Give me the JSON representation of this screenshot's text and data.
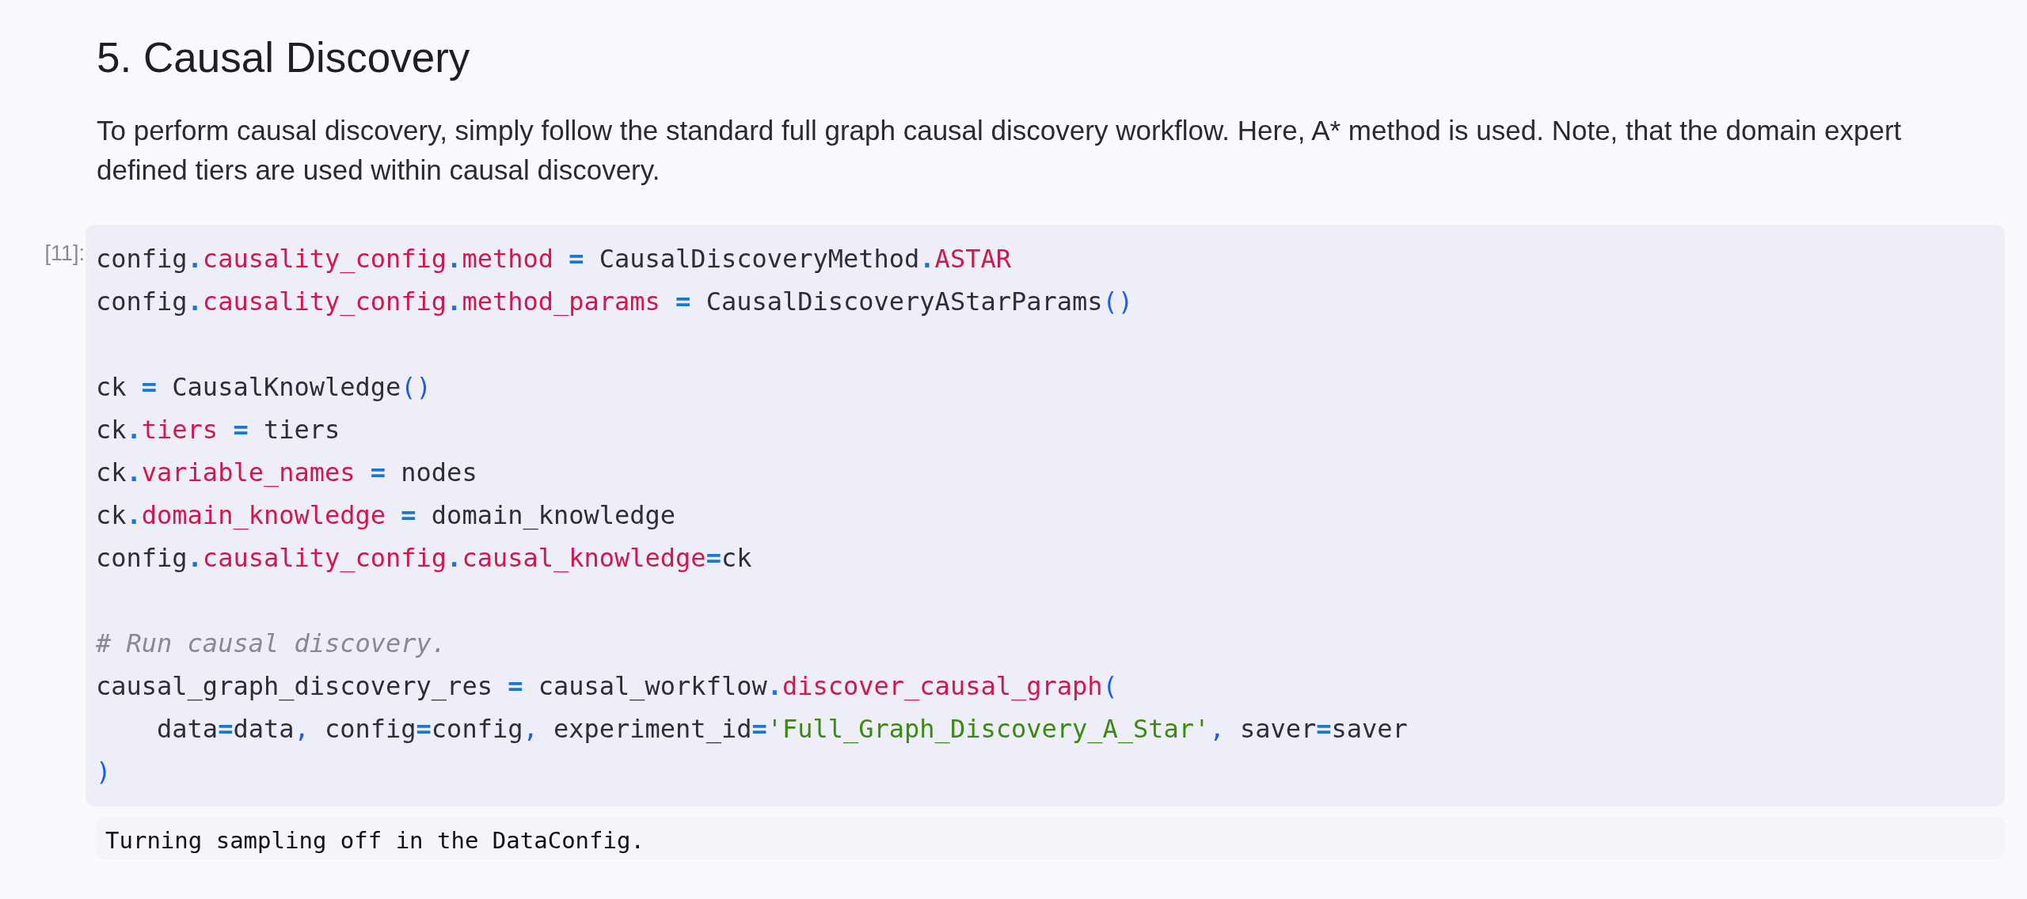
{
  "markdown": {
    "heading": "5. Causal Discovery",
    "paragraph": "To perform causal discovery, simply follow the standard full graph causal discovery workflow. Here, A* method is used. Note, that the domain expert defined tiers are used within causal discovery."
  },
  "code_cell": {
    "prompt": "[11]:",
    "blocks": [
      {
        "lines": [
          [
            {
              "kind": "name",
              "text": "config"
            },
            {
              "kind": "op",
              "text": "."
            },
            {
              "kind": "attr",
              "text": "causality_config"
            },
            {
              "kind": "op",
              "text": "."
            },
            {
              "kind": "attr",
              "text": "method"
            },
            {
              "kind": "op",
              "text": " = "
            },
            {
              "kind": "name",
              "text": "CausalDiscoveryMethod"
            },
            {
              "kind": "op",
              "text": "."
            },
            {
              "kind": "attr",
              "text": "ASTAR"
            }
          ],
          [
            {
              "kind": "name",
              "text": "config"
            },
            {
              "kind": "op",
              "text": "."
            },
            {
              "kind": "attr",
              "text": "causality_config"
            },
            {
              "kind": "op",
              "text": "."
            },
            {
              "kind": "attr",
              "text": "method_params"
            },
            {
              "kind": "op",
              "text": " = "
            },
            {
              "kind": "name",
              "text": "CausalDiscoveryAStarParams"
            },
            {
              "kind": "punct",
              "text": "()"
            }
          ]
        ]
      },
      {
        "lines": [
          [
            {
              "kind": "name",
              "text": "ck"
            },
            {
              "kind": "op",
              "text": " = "
            },
            {
              "kind": "name",
              "text": "CausalKnowledge"
            },
            {
              "kind": "punct",
              "text": "()"
            }
          ],
          [
            {
              "kind": "name",
              "text": "ck"
            },
            {
              "kind": "op",
              "text": "."
            },
            {
              "kind": "attr",
              "text": "tiers"
            },
            {
              "kind": "op",
              "text": " = "
            },
            {
              "kind": "name",
              "text": "tiers"
            }
          ],
          [
            {
              "kind": "name",
              "text": "ck"
            },
            {
              "kind": "op",
              "text": "."
            },
            {
              "kind": "attr",
              "text": "variable_names"
            },
            {
              "kind": "op",
              "text": " = "
            },
            {
              "kind": "name",
              "text": "nodes"
            }
          ],
          [
            {
              "kind": "name",
              "text": "ck"
            },
            {
              "kind": "op",
              "text": "."
            },
            {
              "kind": "attr",
              "text": "domain_knowledge"
            },
            {
              "kind": "op",
              "text": " = "
            },
            {
              "kind": "name",
              "text": "domain_knowledge"
            }
          ],
          [
            {
              "kind": "name",
              "text": "config"
            },
            {
              "kind": "op",
              "text": "."
            },
            {
              "kind": "attr",
              "text": "causality_config"
            },
            {
              "kind": "op",
              "text": "."
            },
            {
              "kind": "attr",
              "text": "causal_knowledge"
            },
            {
              "kind": "op",
              "text": "="
            },
            {
              "kind": "name",
              "text": "ck"
            }
          ]
        ]
      },
      {
        "lines": [
          [
            {
              "kind": "comment",
              "text": "# Run causal discovery."
            }
          ],
          [
            {
              "kind": "name",
              "text": "causal_graph_discovery_res"
            },
            {
              "kind": "op",
              "text": " = "
            },
            {
              "kind": "name",
              "text": "causal_workflow"
            },
            {
              "kind": "op",
              "text": "."
            },
            {
              "kind": "attr",
              "text": "discover_causal_graph"
            },
            {
              "kind": "punct",
              "text": "("
            }
          ],
          [
            {
              "kind": "name",
              "text": "    data"
            },
            {
              "kind": "op",
              "text": "="
            },
            {
              "kind": "name",
              "text": "data"
            },
            {
              "kind": "punct",
              "text": ","
            },
            {
              "kind": "name",
              "text": " config"
            },
            {
              "kind": "op",
              "text": "="
            },
            {
              "kind": "name",
              "text": "config"
            },
            {
              "kind": "punct",
              "text": ","
            },
            {
              "kind": "name",
              "text": " experiment_id"
            },
            {
              "kind": "op",
              "text": "="
            },
            {
              "kind": "string",
              "text": "'Full_Graph_Discovery_A_Star'"
            },
            {
              "kind": "punct",
              "text": ","
            },
            {
              "kind": "name",
              "text": " saver"
            },
            {
              "kind": "op",
              "text": "="
            },
            {
              "kind": "name",
              "text": "saver"
            }
          ],
          [
            {
              "kind": "punct",
              "text": ")"
            }
          ]
        ]
      }
    ]
  },
  "output": {
    "text": "Turning sampling off in the DataConfig."
  }
}
